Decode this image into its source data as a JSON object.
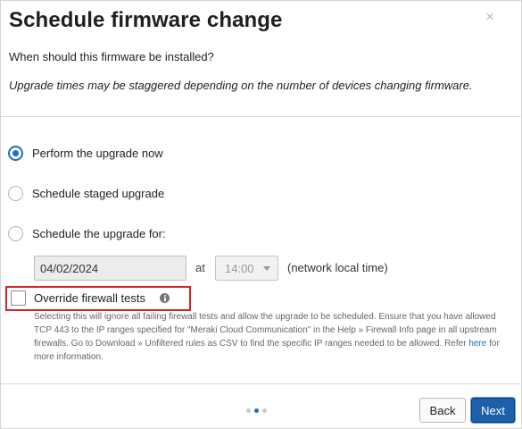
{
  "dialog": {
    "title": "Schedule firmware change",
    "close_glyph": "×",
    "question": "When should this firmware be installed?",
    "note": "Upgrade times may be staggered depending on the number of devices changing firmware."
  },
  "options": [
    {
      "label": "Perform the upgrade now",
      "checked": true
    },
    {
      "label": "Schedule staged upgrade",
      "checked": false
    },
    {
      "label": "Schedule the upgrade for:",
      "checked": false
    }
  ],
  "schedule": {
    "date_value": "04/02/2024",
    "at_label": "at",
    "time_value": "14:00",
    "timezone_label": "(network local time)"
  },
  "override": {
    "label": "Override firewall tests",
    "checked": false,
    "help_text_before_link": "Selecting this will ignore all failing firewall tests and allow the upgrade to be scheduled. Ensure that you have allowed TCP 443 to the IP ranges specified for \"Meraki Cloud Communication\" in the Help » Firewall Info page in all upstream firewalls. Go to Download » Unfiltered rules as CSV to find the specific IP ranges needed to be allowed. Refer ",
    "help_link": "here",
    "help_text_after_link": " for more information."
  },
  "pager": {
    "total": 3,
    "current": 2
  },
  "buttons": {
    "back": "Back",
    "next": "Next"
  },
  "colors": {
    "accent": "#1b6fc8",
    "highlight": "#d6232a",
    "primary_button": "#1d5fa8"
  },
  "icons": {
    "close": "close-icon",
    "info": "info-icon",
    "dropdown": "chevron-down-icon"
  }
}
